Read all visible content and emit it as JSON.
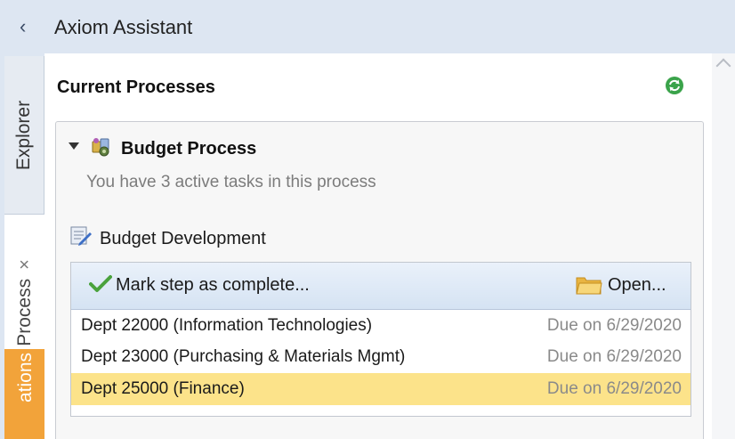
{
  "window": {
    "title": "Axiom Assistant",
    "collapse_icon": "chevron-left-icon"
  },
  "side_tabs": [
    {
      "label": "Explorer"
    },
    {
      "label": "Process",
      "close": "×",
      "active": true
    },
    {
      "label": "ations",
      "color": "#f2a33a"
    }
  ],
  "panel": {
    "section_title": "Current Processes",
    "refresh_icon": "refresh-icon",
    "refresh_color": "#3aa34a"
  },
  "process": {
    "name": "Budget Process",
    "subtitle": "You have 3 active tasks in this process",
    "step_name": "Budget Development",
    "mark_complete_label": "Mark step as complete...",
    "open_label": "Open...",
    "tasks": [
      {
        "name": "Dept 22000 (Information Technologies)",
        "due": "Due on 6/29/2020",
        "selected": false
      },
      {
        "name": "Dept 23000 (Purchasing & Materials Mgmt)",
        "due": "Due on 6/29/2020",
        "selected": false
      },
      {
        "name": "Dept 25000 (Finance)",
        "due": "Due on 6/29/2020",
        "selected": true
      }
    ]
  },
  "colors": {
    "selection": "#fce38a",
    "notification_tab": "#f2a33a",
    "toolbar": "#dde8f5"
  }
}
